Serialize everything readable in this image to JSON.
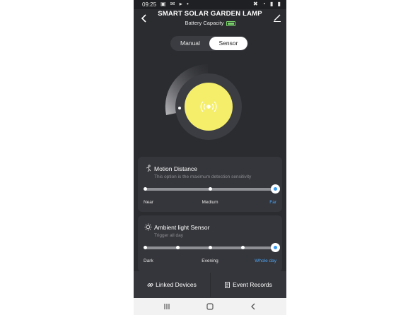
{
  "status": {
    "time": "09:25",
    "left_icons": "▣ ✉ ▸ •",
    "right_icons": "✖ ◔ ▮ ▮"
  },
  "header": {
    "title": "SMART SOLAR GARDEN LAMP",
    "subtitle": "Battery Capacity"
  },
  "mode": {
    "manual_label": "Manual",
    "sensor_label": "Sensor",
    "selected": "Sensor"
  },
  "colors": {
    "lamp": "#f4ee6a",
    "accent": "#3a9bf0",
    "battery": "#7ad36b"
  },
  "motion": {
    "title": "Motion Distance",
    "desc": "This option is the maximum detection sensitivity",
    "labels": [
      "Near",
      "Medium",
      "Far"
    ],
    "steps": 3,
    "selected_index": 2
  },
  "ambient": {
    "title": "Ambient light Sensor",
    "desc": "Trigger all day",
    "labels": [
      "Dark",
      "Evening",
      "Whole day"
    ],
    "steps": 5,
    "selected_index": 4
  },
  "bottom": {
    "linked": "Linked Devices",
    "events": "Event Records"
  },
  "icons": {
    "back": "back-arrow-icon",
    "edit": "pencil-icon",
    "lamp": "radar-icon",
    "motion": "running-person-icon",
    "ambient": "sun-icon",
    "linked": "link-icon",
    "events": "document-icon"
  }
}
